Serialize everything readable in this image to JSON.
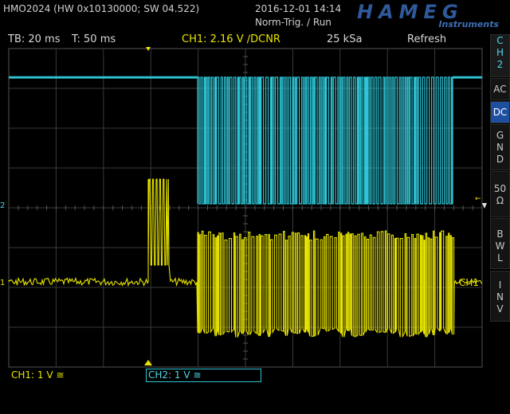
{
  "header": {
    "device": "HMO2024 (HW 0x10130000; SW 04.522)",
    "datetime": "2016-12-01 14:14",
    "trigger_mode": "Norm-Trig. / Run",
    "logo_main": "HAMEG",
    "logo_sub": "Instruments"
  },
  "status_bar": {
    "timebase": "TB: 20 ms",
    "trigger_time": "T: 50 ms",
    "ch1_trigger": "CH1: 2.16 V ∕DCNR",
    "sample_rate": "25 kSa",
    "mode": "Refresh"
  },
  "side_menu": {
    "channel": [
      "C",
      "H",
      "2"
    ],
    "ac": "AC",
    "dc": "DC",
    "gnd": [
      "G",
      "N",
      "D"
    ],
    "ohm": [
      "50",
      "Ω"
    ],
    "bwl": [
      "B",
      "W",
      "L"
    ],
    "inv": [
      "I",
      "N",
      "V"
    ]
  },
  "markers": {
    "ch1_level": "CH1",
    "ch1_ref": "1",
    "ch2_ref": "2"
  },
  "bottom": {
    "ch1_setting": "CH1: 1 V ≅",
    "ch2_setting": "CH2: 1 V ≅"
  },
  "colors": {
    "ch1": "#e8e400",
    "ch2": "#2ec6d6",
    "grid": "#3a3a3a",
    "accent": "#1e4f9e"
  }
}
